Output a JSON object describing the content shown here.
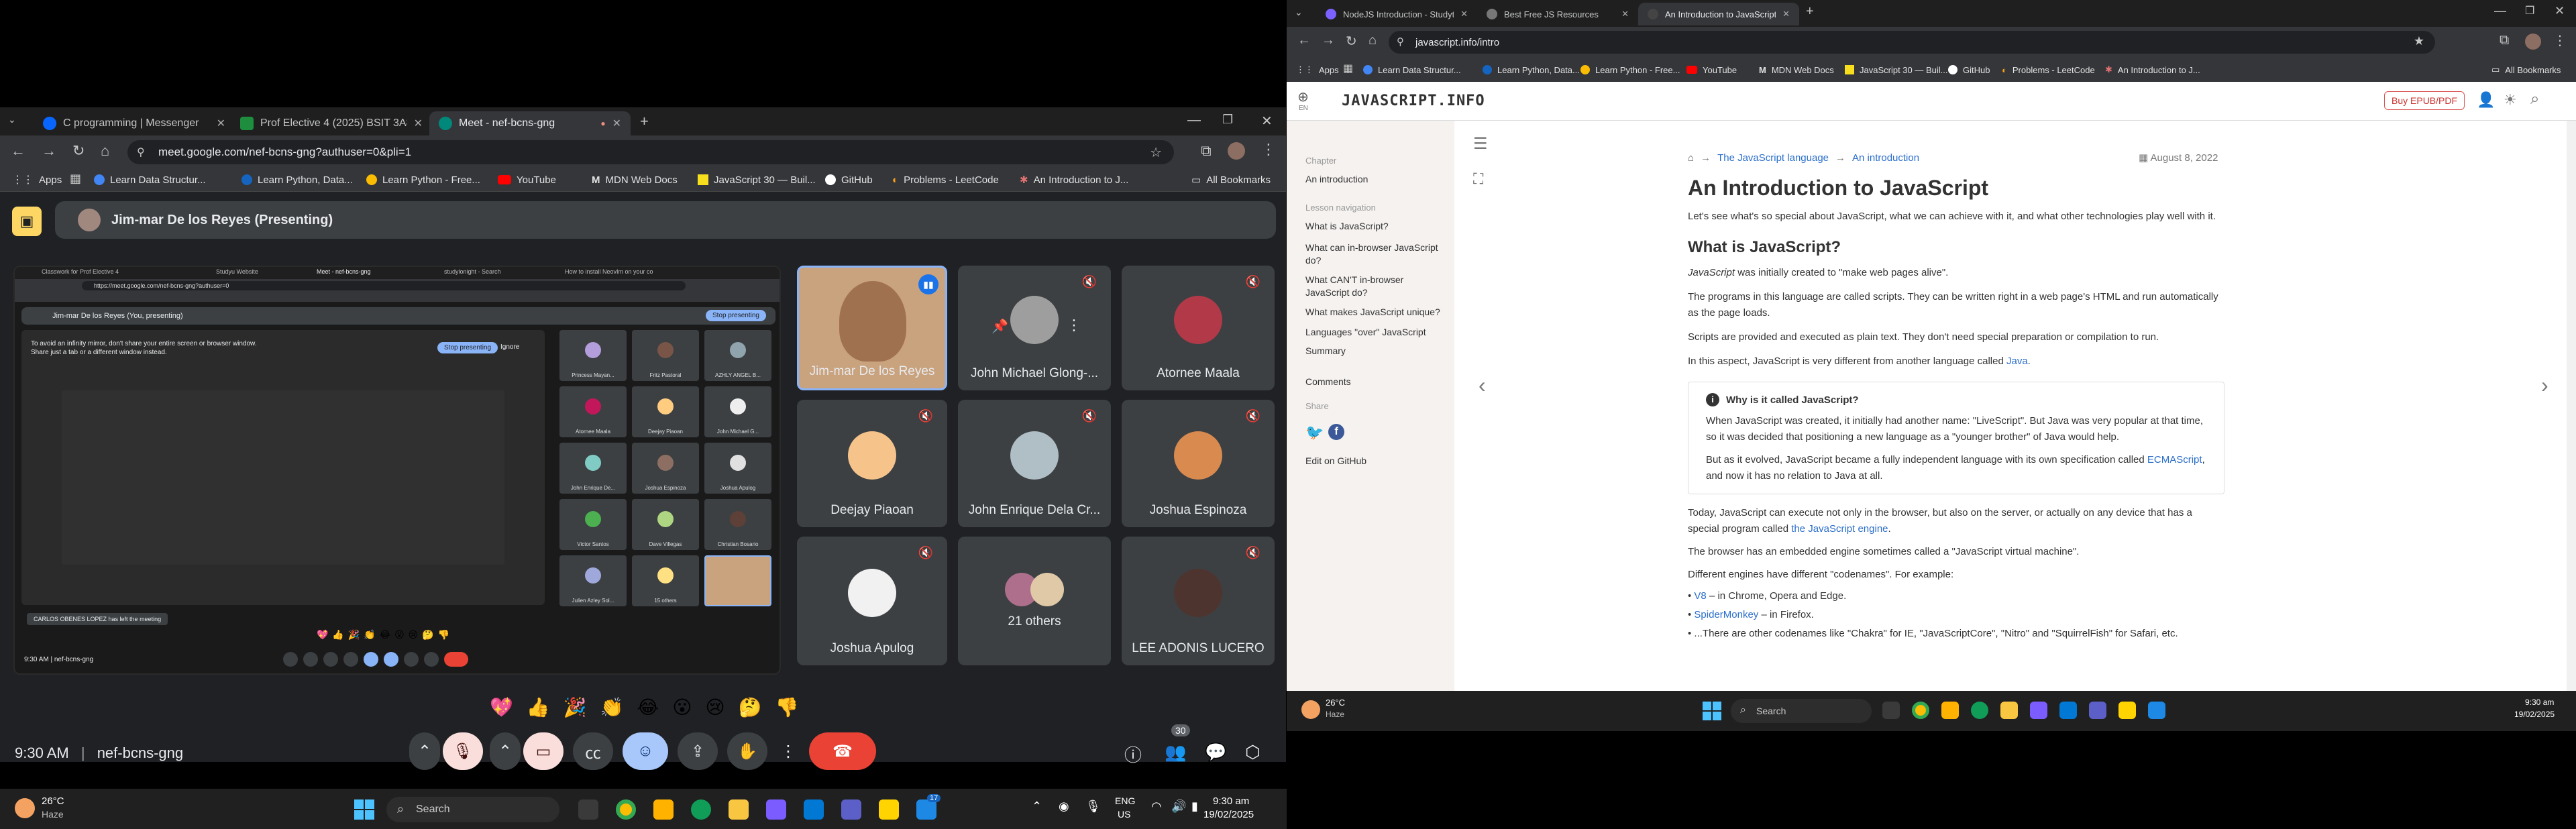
{
  "left_window": {
    "tabs": [
      {
        "label": "C programming | Messenger",
        "color": "#0866ff"
      },
      {
        "label": "Prof Elective 4 (2025) BSIT 3A8",
        "color": "#1e8e3e"
      },
      {
        "label": "Meet - nef-bcns-gng",
        "color": "#00897b"
      }
    ],
    "url": "meet.google.com/nef-bcns-gng?authuser=0&pli=1",
    "bookmarks": [
      "Apps",
      "Learn Data Structur...",
      "Learn Python, Data...",
      "Learn Python - Free...",
      "YouTube",
      "MDN Web Docs",
      "JavaScript 30 — Buil...",
      "GitHub",
      "Problems - LeetCode",
      "An Introduction to J..."
    ],
    "all_bookmarks": "All Bookmarks"
  },
  "meet": {
    "presenter_label": "Jim-mar De los Reyes (Presenting)",
    "shared_screen": {
      "tabs": [
        "Classwork for Prof Elective 4",
        "Studyu Website",
        "Meet - nef-bcns-gng",
        "studylonight - Search",
        "How to install NeovIm on your co"
      ],
      "url": "https://meet.google.com/nef-bcns-gng?authuser=0",
      "presenting_bar": "Jim-mar De los Reyes (You, presenting)",
      "stop_presenting": "Stop presenting",
      "mirror_warning": "To avoid an infinity mirror, don't share your entire screen or browser window. Share just a tab or a different window instead.",
      "ignore": "Ignore",
      "left_toast": "CARLOS OBENES LOPEZ has left the meeting",
      "time_code": "9:30 AM  |  nef-bcns-gng",
      "mini_names": [
        "Princess Mayan...",
        "Fritz Pastoral",
        "AZHLY ANGEL B...",
        "Atornee Maala",
        "Deejay Piaoan",
        "John Michael G...",
        "John Enrique De...",
        "Joshua Espinoza",
        "Joshua Apulog",
        "Victor Santos",
        "Dave Villegas",
        "Christian Bosario",
        "Julien Azley Sol...",
        "15 others"
      ]
    },
    "participants": [
      {
        "name": "Jim-mar De los Reyes"
      },
      {
        "name": "John Michael Glong-..."
      },
      {
        "name": "Atornee Maala"
      },
      {
        "name": "Deejay Piaoan"
      },
      {
        "name": "John Enrique Dela Cr..."
      },
      {
        "name": "Joshua Espinoza"
      },
      {
        "name": "Joshua Apulog"
      },
      {
        "name": "21 others"
      },
      {
        "name": "LEE ADONIS LUCERO"
      }
    ],
    "reactions": [
      "💖",
      "👍",
      "🎉",
      "👏",
      "😂",
      "😮",
      "😢",
      "🤔",
      "👎"
    ],
    "time": "9:30 AM",
    "separator": "|",
    "meeting_code": "nef-bcns-gng",
    "people_count": "30"
  },
  "taskbar_left": {
    "weather_temp": "26°C",
    "weather_cond": "Haze",
    "search": "Search",
    "lang_top": "ENG",
    "lang_bottom": "US",
    "time": "9:30 am",
    "date": "19/02/2025",
    "badge": "17"
  },
  "right_window": {
    "tabs": [
      {
        "label": "NodeJS Introduction - Studyto",
        "color": "#7b61ff"
      },
      {
        "label": "Best Free JS Resources",
        "color": "#555555"
      },
      {
        "label": "An Introduction to JavaScript",
        "color": "#3d3d3d"
      }
    ],
    "url": "javascript.info/intro",
    "bookmarks": [
      "Apps",
      "Learn Data Structur...",
      "Learn Python, Data...",
      "Learn Python - Free...",
      "YouTube",
      "MDN Web Docs",
      "JavaScript 30 — Buil...",
      "GitHub",
      "Problems - LeetCode",
      "An Introduction to J..."
    ],
    "all_bookmarks": "All Bookmarks"
  },
  "jsinfo": {
    "logo": "JAVASCRIPT.INFO",
    "lang": "EN",
    "buy": "Buy EPUB/PDF",
    "sidebar": {
      "chapter_cap": "Chapter",
      "chapter": "An introduction",
      "nav_cap": "Lesson navigation",
      "nav": [
        "What is JavaScript?",
        "What can in-browser JavaScript do?",
        "What CAN'T in-browser JavaScript do?",
        "What makes JavaScript unique?",
        "Languages \"over\" JavaScript",
        "Summary"
      ],
      "comments": "Comments",
      "share_cap": "Share",
      "edit": "Edit on GitHub"
    },
    "breadcrumb": [
      "The JavaScript language",
      "An introduction"
    ],
    "date": "August 8, 2022",
    "title": "An Introduction to JavaScript",
    "intro": "Let's see what's so special about JavaScript, what we can achieve with it, and what other technologies play well with it.",
    "h2": "What is JavaScript?",
    "p1_em": "JavaScript",
    "p1_rest": " was initially created to \"make web pages alive\".",
    "p2": "The programs in this language are called scripts. They can be written right in a web page's HTML and run automatically as the page loads.",
    "p3": "Scripts are provided and executed as plain text. They don't need special preparation or compilation to run.",
    "p4_pre": "In this aspect, JavaScript is very different from another language called ",
    "p4_link": "Java",
    "p4_post": ".",
    "note_title": "Why is it called JavaScript?",
    "note_p1": "When JavaScript was created, it initially had another name: \"LiveScript\". But Java was very popular at that time, so it was decided that positioning a new language as a \"younger brother\" of Java would help.",
    "note_p2_pre": "But as it evolved, JavaScript became a fully independent language with its own specification called ",
    "note_p2_link": "ECMAScript",
    "note_p2_post": ", and now it has no relation to Java at all.",
    "p5_pre": "Today, JavaScript can execute not only in the browser, but also on the server, or actually on any device that has a special program called ",
    "p5_link": "the JavaScript engine",
    "p5_post": ".",
    "p6": "The browser has an embedded engine sometimes called a \"JavaScript virtual machine\".",
    "p7": "Different engines have different \"codenames\". For example:",
    "li1_link": "V8",
    "li1_rest": " – in Chrome, Opera and Edge.",
    "li2_link": "SpiderMonkey",
    "li2_rest": " – in Firefox.",
    "li3": "...There are other codenames like \"Chakra\" for IE, \"JavaScriptCore\", \"Nitro\" and \"SquirrelFish\" for Safari, etc."
  },
  "taskbar_right": {
    "weather_temp": "26°C",
    "weather_cond": "Haze",
    "search": "Search",
    "time": "9:30 am",
    "date": "19/02/2025"
  }
}
